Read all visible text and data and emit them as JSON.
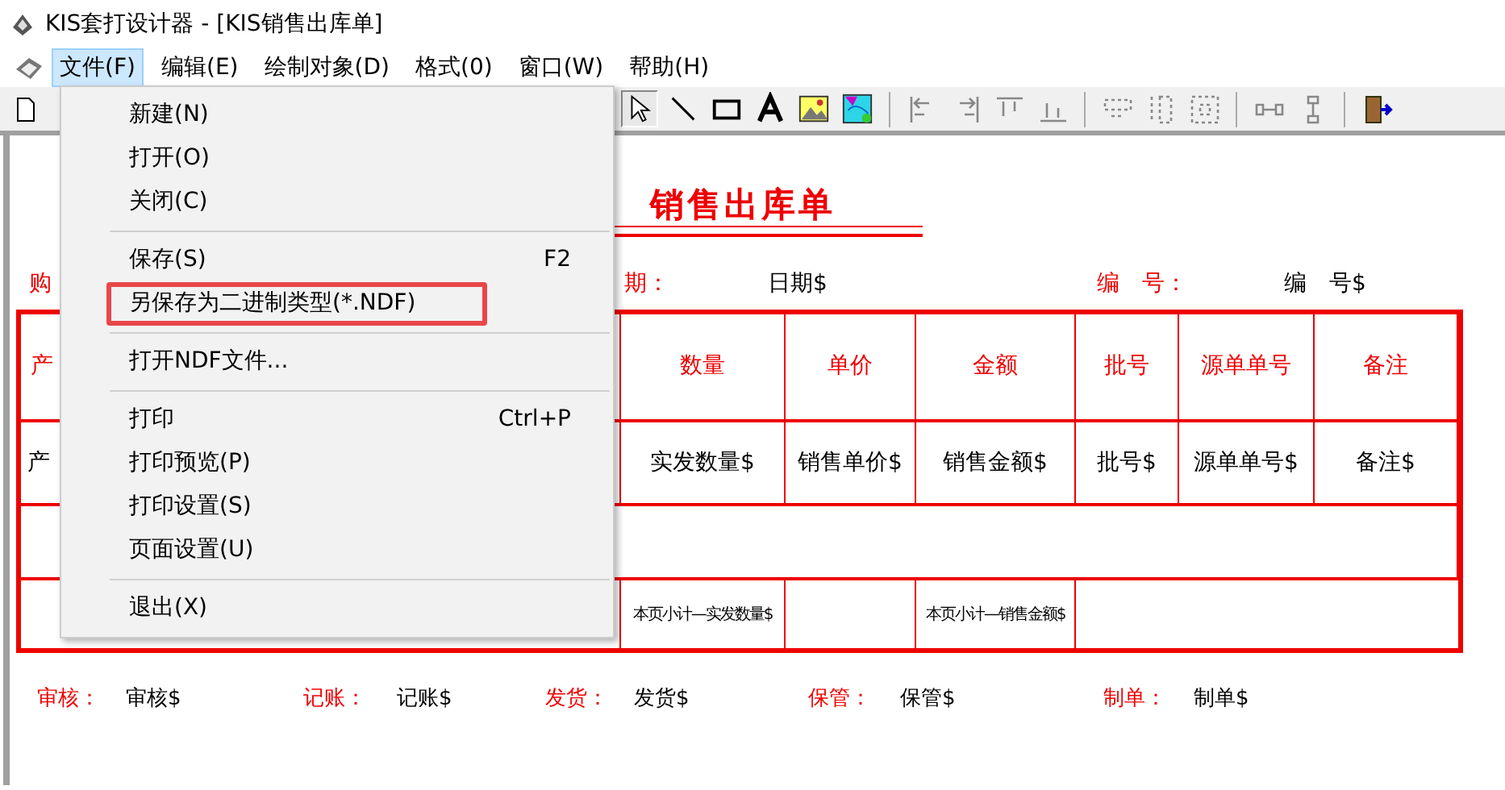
{
  "window": {
    "title": "KIS套打设计器 - [KIS销售出库单]"
  },
  "menu_bar": [
    {
      "label": "文件(F)",
      "selected": true
    },
    {
      "label": "编辑(E)",
      "selected": false
    },
    {
      "label": "绘制对象(D)",
      "selected": false
    },
    {
      "label": "格式(0)",
      "selected": false
    },
    {
      "label": "窗口(W)",
      "selected": false
    },
    {
      "label": "帮助(H)",
      "selected": false
    }
  ],
  "tools": [
    {
      "kind": "pointer",
      "selected": true
    },
    {
      "kind": "line",
      "selected": false
    },
    {
      "kind": "rectangle",
      "selected": false
    },
    {
      "kind": "text",
      "selected": false
    },
    {
      "kind": "image",
      "selected": false
    },
    {
      "kind": "picture",
      "selected": false
    }
  ],
  "file_menu": [
    {
      "kind": "item",
      "label": "新建(N)",
      "highlighted": false
    },
    {
      "kind": "item",
      "label": "打开(O)",
      "highlighted": false
    },
    {
      "kind": "item",
      "label": "关闭(C)",
      "highlighted": false
    },
    {
      "kind": "separator"
    },
    {
      "kind": "item",
      "label": "保存(S)",
      "shortcut": "F2",
      "highlighted": false
    },
    {
      "kind": "item",
      "label": "另保存为二进制类型(*.NDF)",
      "highlighted": true
    },
    {
      "kind": "separator"
    },
    {
      "kind": "item",
      "label": "打开NDF文件...",
      "highlighted": false
    },
    {
      "kind": "separator"
    },
    {
      "kind": "item",
      "label": "打印",
      "shortcut": "Ctrl+P",
      "highlighted": false
    },
    {
      "kind": "item",
      "label": "打印预览(P)",
      "highlighted": false
    },
    {
      "kind": "item",
      "label": "打印设置(S)",
      "highlighted": false
    },
    {
      "kind": "item",
      "label": "页面设置(U)",
      "highlighted": false
    },
    {
      "kind": "separator"
    },
    {
      "kind": "item",
      "label": "退出(X)",
      "highlighted": false
    }
  ],
  "form": {
    "title": "销售出库单",
    "header_fields": [
      {
        "kind": "label",
        "text": "购"
      },
      {
        "kind": "label",
        "text": "期："
      },
      {
        "kind": "value",
        "text": "日期$"
      },
      {
        "kind": "label",
        "text": "编　号："
      },
      {
        "kind": "value",
        "text": "编　号$"
      }
    ],
    "table": {
      "columns": [
        "产",
        "数量",
        "单价",
        "金额",
        "批号",
        "源单单号",
        "备注"
      ],
      "data_row": [
        "产",
        "实发数量$",
        "销售单价$",
        "销售金额$",
        "批号$",
        "源单单号$",
        "备注$"
      ],
      "subtotal_row": [
        "本页小计—实发数量$",
        "本页小计—销售金额$"
      ]
    },
    "footer_fields": [
      {
        "label": "审核：",
        "value": "审核$"
      },
      {
        "label": "记账：",
        "value": "记账$"
      },
      {
        "label": "发货：",
        "value": "发货$"
      },
      {
        "label": "保管：",
        "value": "保管$"
      },
      {
        "label": "制单：",
        "value": "制单$"
      }
    ]
  }
}
